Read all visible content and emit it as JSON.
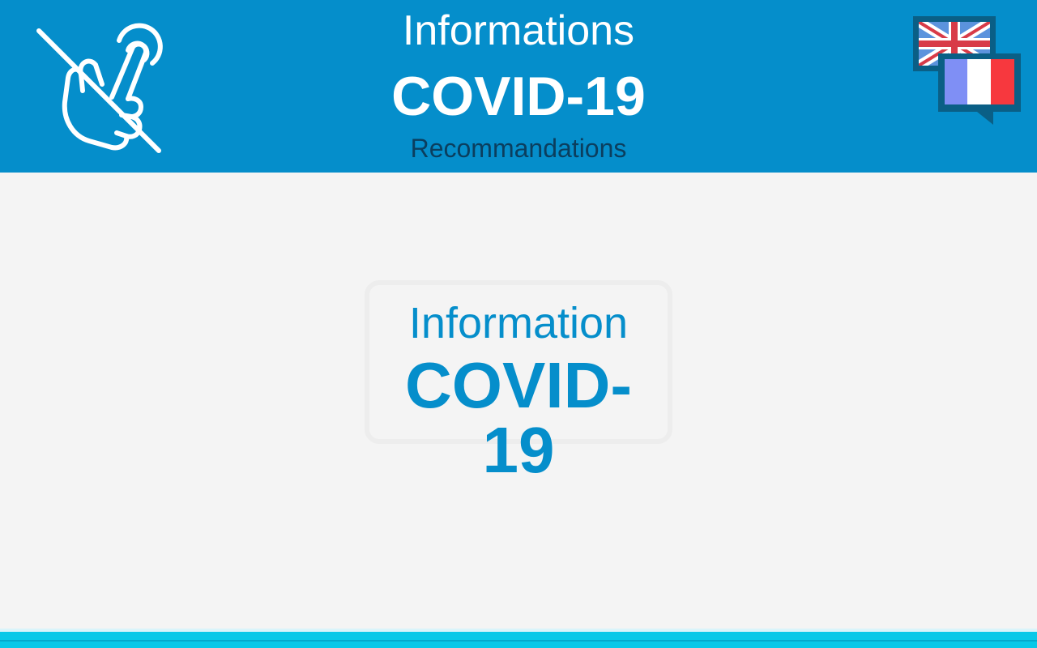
{
  "header": {
    "title_line1": "Informations",
    "title_line2": "COVID-19",
    "subtitle": "Recommandations",
    "background_color": "#058ecb",
    "left_icon": "no-touch-hand-icon",
    "right_icon": "language-switch-flags-icon"
  },
  "card": {
    "line1": "Information",
    "line2": "COVID-19",
    "text_color": "#058ecb"
  },
  "colors": {
    "page_background": "#f4f4f4",
    "subtitle": "#0b3e5e",
    "bottom_bar": "#08c8e8"
  }
}
